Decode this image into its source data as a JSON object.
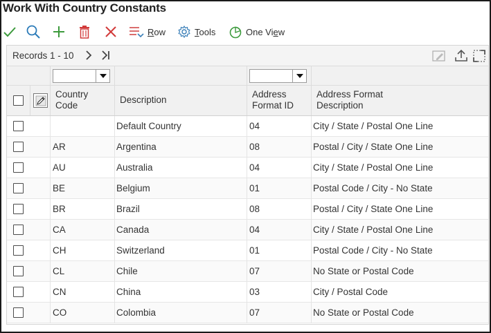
{
  "title": "Work With Country Constants",
  "toolbar": {
    "row_label": "Row",
    "row_key": "R",
    "tools_label": "Tools",
    "tools_key": "T",
    "oneview_label_pre": "One Vi",
    "oneview_key": "e",
    "oneview_label_post": "w"
  },
  "records": {
    "label": "Records 1 - 10",
    "next": "›",
    "last": "›|"
  },
  "columns": {
    "country_code": [
      "Country",
      "Code"
    ],
    "description": "Description",
    "address_format_id": [
      "Address",
      "Format ID"
    ],
    "address_format_description": [
      "Address Format",
      "Description"
    ]
  },
  "qbe": {
    "country_code_value": "",
    "address_format_id_value": ""
  },
  "rows": [
    {
      "code": "",
      "description": "Default Country",
      "format_id": "04",
      "format_desc": "City / State / Postal One Line"
    },
    {
      "code": "AR",
      "description": "Argentina",
      "format_id": "08",
      "format_desc": "Postal / City / State One Line"
    },
    {
      "code": "AU",
      "description": "Australia",
      "format_id": "04",
      "format_desc": "City / State / Postal One Line"
    },
    {
      "code": "BE",
      "description": "Belgium",
      "format_id": "01",
      "format_desc": "Postal Code / City - No State"
    },
    {
      "code": "BR",
      "description": "Brazil",
      "format_id": "08",
      "format_desc": "Postal / City / State One Line"
    },
    {
      "code": "CA",
      "description": "Canada",
      "format_id": "04",
      "format_desc": "City / State / Postal One Line"
    },
    {
      "code": "CH",
      "description": "Switzerland",
      "format_id": "01",
      "format_desc": "Postal Code / City - No State"
    },
    {
      "code": "CL",
      "description": "Chile",
      "format_id": "07",
      "format_desc": "No State or Postal Code"
    },
    {
      "code": "CN",
      "description": "China",
      "format_id": "03",
      "format_desc": "City / Postal Code"
    },
    {
      "code": "CO",
      "description": "Colombia",
      "format_id": "07",
      "format_desc": "No State or Postal Code"
    }
  ],
  "colors": {
    "ok": "#3c9a3c",
    "search": "#2a7ab8",
    "add": "#3c9a3c",
    "delete": "#d23a3a",
    "close": "#d23a3a",
    "row_icon": "#d04848",
    "tools_icon": "#3a7fb8",
    "oneview_icon": "#3c9a3c"
  },
  "icons": {
    "ok": "checkmark-icon",
    "search": "search-icon",
    "add": "plus-icon",
    "delete": "trash-icon",
    "close": "close-icon",
    "row": "row-menu-icon",
    "tools": "gear-icon",
    "oneview": "pie-chart-icon",
    "personalize": "edit-grid-icon",
    "export": "export-icon",
    "maximize": "maximize-icon"
  }
}
